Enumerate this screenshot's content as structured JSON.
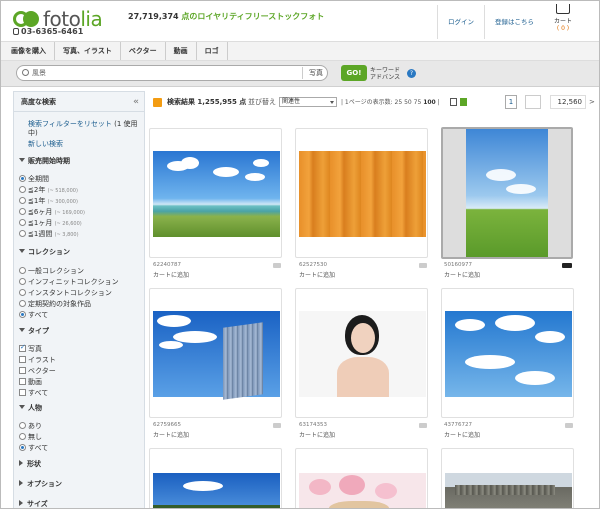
{
  "header": {
    "logo_prefix": "foto",
    "logo_suffix": "lia",
    "phone": "03-6365-6461",
    "tagline_count": "27,719,374",
    "tagline_text": " 点のロイヤリティフリーストックフォト",
    "login": "ログイン",
    "register": "登録はこちら",
    "cart_label": "カート",
    "cart_count": "( 0 )"
  },
  "nav": {
    "items": [
      "画像を購入",
      "写真、イラスト",
      "ベクター",
      "動画",
      "ロゴ"
    ]
  },
  "search": {
    "value": "風景",
    "type": "写真",
    "go": "GO!",
    "kw_line1": "キーワード",
    "kw_line2": "アドバンス",
    "help": "?"
  },
  "sidebar": {
    "title": "高度な検索",
    "collapse": "«",
    "reset": "検索フィルターをリセット",
    "reset_count": " (1 使用中)",
    "new_search": "新しい検索",
    "sections": {
      "period": "販売開始時期",
      "collection": "コレクション",
      "type": "タイプ",
      "people": "人物",
      "shape": "形状",
      "option": "オプション",
      "size": "サイズ"
    },
    "period_options": [
      {
        "label": "全期間",
        "count": ""
      },
      {
        "label": "≦2年",
        "count": "(~ 518,000)"
      },
      {
        "label": "≦1年",
        "count": "(~ 300,000)"
      },
      {
        "label": "≦6ヶ月",
        "count": "(~ 169,000)"
      },
      {
        "label": "≦1ヶ月",
        "count": "(~ 26,600)"
      },
      {
        "label": "≦1週間",
        "count": "(~ 3,800)"
      }
    ],
    "collection_options": [
      "一般コレクション",
      "インフィニットコレクション",
      "インスタントコレクション",
      "定期契約の対象作品",
      "すべて"
    ],
    "type_options": [
      "写真",
      "イラスト",
      "ベクター",
      "動画",
      "すべて"
    ],
    "people_options": [
      "あり",
      "無し",
      "すべて"
    ]
  },
  "results": {
    "title": "検索結果 1,255,955 点",
    "sort_label": "並び替え",
    "sort_value": "関連性",
    "perpage": "| 1ページの表示数: 25 50 75 ",
    "perpage_bold": "100",
    "perpage_tail": " |",
    "page_current": "1",
    "page_total": "12,560",
    "next": ">"
  },
  "cards": [
    {
      "id": "62240787",
      "add": "カートに追加"
    },
    {
      "id": "62527530",
      "add": "カートに追加"
    },
    {
      "id": "50160977",
      "add": "カートに追加"
    },
    {
      "id": "62759665",
      "add": "カートに追加"
    },
    {
      "id": "63174353",
      "add": "カートに追加"
    },
    {
      "id": "43776727",
      "add": "カートに追加"
    }
  ],
  "colors": {
    "brand_green": "#5ca626",
    "link_blue": "#1a5c8e",
    "rss_orange": "#f39c12"
  }
}
